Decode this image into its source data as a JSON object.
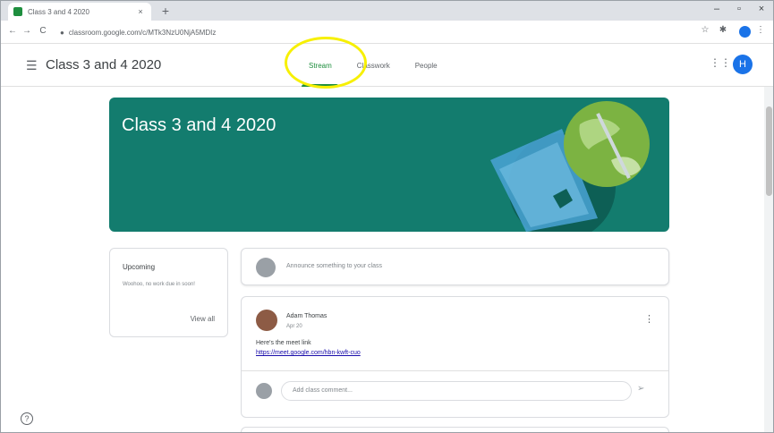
{
  "browser": {
    "tab_title": "Class 3 and 4 2020",
    "tab_close": "×",
    "new_tab": "+",
    "window_controls": [
      "–",
      "▫",
      "×"
    ],
    "nav": [
      "←",
      "→",
      "C"
    ],
    "url": "classroom.google.com/c/MTk3NzU0NjA5MDIz",
    "tools": [
      "☆",
      "✱",
      "⋮"
    ]
  },
  "header": {
    "title": "Class 3 and 4 2020",
    "tabs": [
      {
        "label": "Stream",
        "active": true
      },
      {
        "label": "Classwork",
        "active": false
      },
      {
        "label": "People",
        "active": false
      }
    ],
    "avatar_letter": "H"
  },
  "banner": {
    "title": "Class 3 and 4 2020",
    "color": "#137c6e"
  },
  "upcoming": {
    "title": "Upcoming",
    "text": "Woohoo, no work due in soon!",
    "link": "View all"
  },
  "announce": {
    "placeholder": "Announce something to your class"
  },
  "post": {
    "author": "Adam Thomas",
    "date": "Apr 20",
    "body": "Here's the meet link",
    "link": "https://meet.google.com/hbn-kwft-cuo",
    "comment_placeholder": "Add class comment..."
  },
  "colors": {
    "accent": "#1e8e3e",
    "highlight": "#f7f004"
  }
}
